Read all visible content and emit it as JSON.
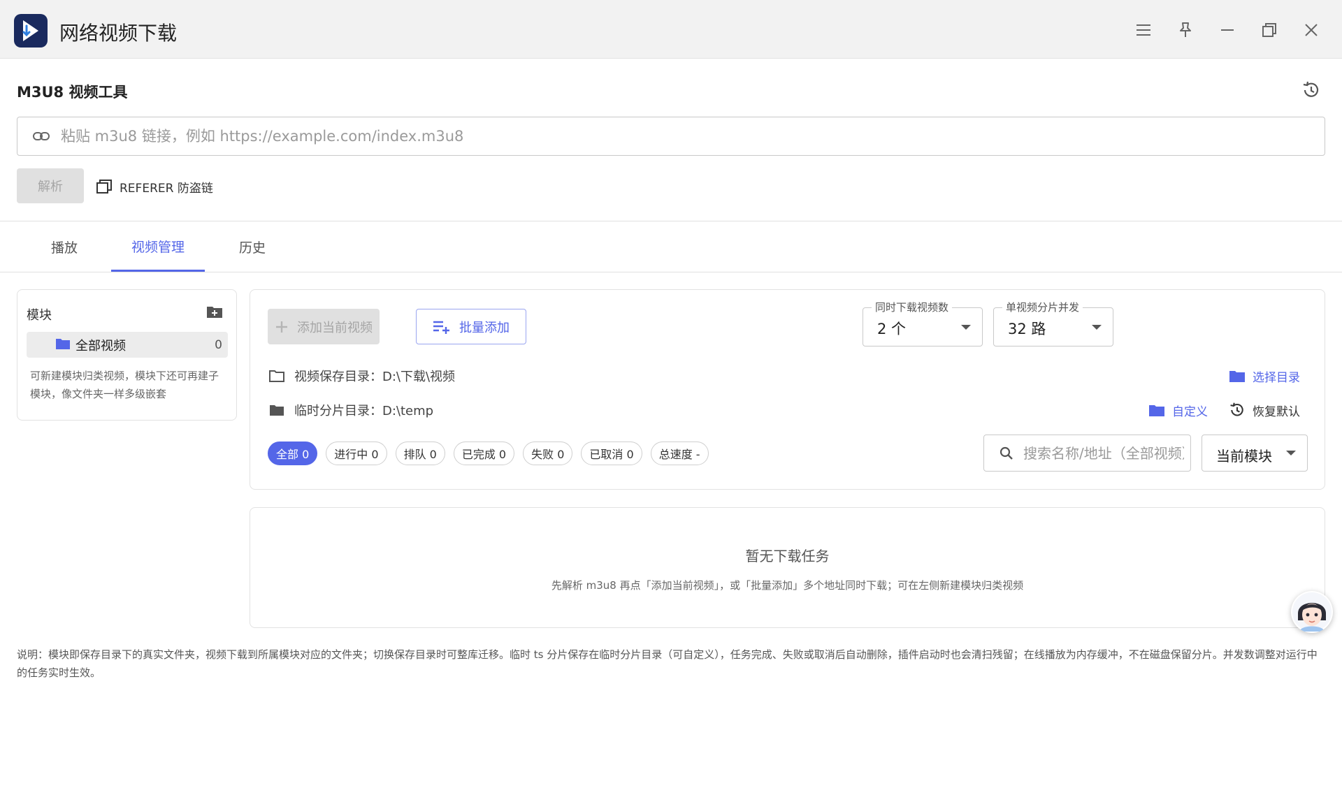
{
  "app": {
    "title": "网络视频下载",
    "accent": "#5466e8"
  },
  "window_controls": [
    "menu-icon",
    "pin-icon",
    "minimize-icon",
    "restore-icon",
    "close-icon"
  ],
  "tool": {
    "title": "M3U8 视频工具",
    "url_placeholder": "粘贴 m3u8 链接，例如 https://example.com/index.m3u8",
    "url_value": "",
    "parse_label": "解析",
    "referer_label": "REFERER 防盗链"
  },
  "tabs": [
    {
      "label": "播放",
      "active": false
    },
    {
      "label": "视频管理",
      "active": true
    },
    {
      "label": "历史",
      "active": false
    }
  ],
  "modules": {
    "title": "模块",
    "items": [
      {
        "name": "全部视频",
        "count": "0"
      }
    ],
    "description": "可新建模块归类视频，模块下还可再建子模块，像文件夹一样多级嵌套"
  },
  "manager": {
    "add_current_label": "添加当前视频",
    "batch_add_label": "批量添加",
    "concurrent_videos": {
      "label": "同时下载视频数",
      "value": "2 个"
    },
    "segment_concurrency": {
      "label": "单视频分片并发",
      "value": "32 路"
    },
    "save_dir": {
      "label": "视频保存目录：D:\\下载\\视频",
      "action": "选择目录"
    },
    "temp_dir": {
      "label": "临时分片目录：D:\\temp",
      "custom_action": "自定义",
      "reset_action": "恢复默认"
    },
    "filters": [
      {
        "label": "全部 0",
        "active": true
      },
      {
        "label": "进行中 0",
        "active": false
      },
      {
        "label": "排队 0",
        "active": false
      },
      {
        "label": "已完成 0",
        "active": false
      },
      {
        "label": "失败 0",
        "active": false
      },
      {
        "label": "已取消 0",
        "active": false
      },
      {
        "label": "总速度 -",
        "active": false
      }
    ],
    "search_placeholder": "搜索名称/地址（全部视频）",
    "scope_value": "当前模块"
  },
  "empty": {
    "title": "暂无下载任务",
    "description": "先解析 m3u8 再点「添加当前视频」，或「批量添加」多个地址同时下载；可在左侧新建模块归类视频"
  },
  "note": "说明：模块即保存目录下的真实文件夹，视频下载到所属模块对应的文件夹；切换保存目录时可整库迁移。临时 ts 分片保存在临时分片目录（可自定义），任务完成、失败或取消后自动删除，插件启动时也会清扫残留；在线播放为内存缓冲，不在磁盘保留分片。并发数调整对运行中的任务实时生效。"
}
